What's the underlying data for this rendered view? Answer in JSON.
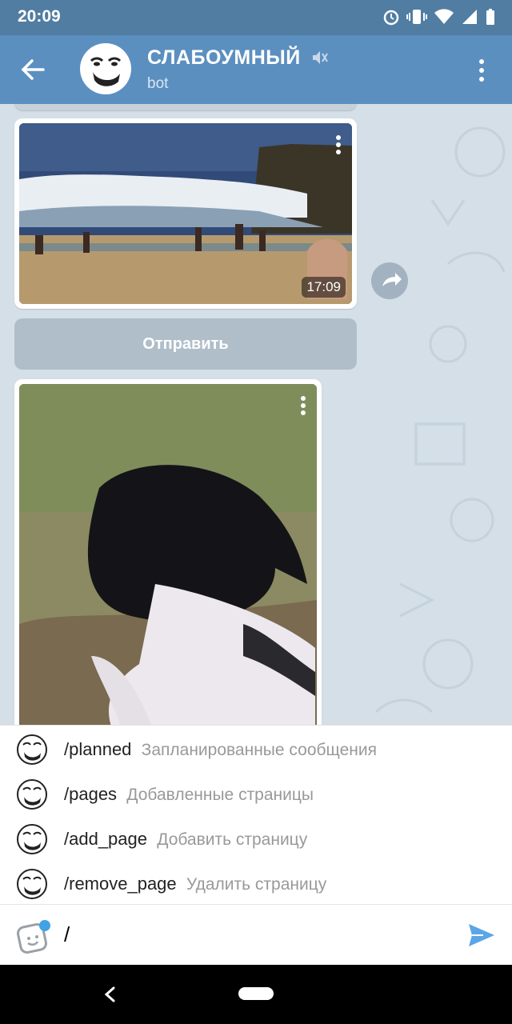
{
  "status_bar": {
    "time": "20:09"
  },
  "header": {
    "title": "СЛАБОУМНЫЙ",
    "subtitle": "bot"
  },
  "chat": {
    "video_duration": "17:09",
    "send_button_label": "Отправить"
  },
  "commands": [
    {
      "name": "/planned",
      "description": "Запланированные сообщения"
    },
    {
      "name": "/pages",
      "description": "Добавленные страницы"
    },
    {
      "name": "/add_page",
      "description": "Добавить страницу"
    },
    {
      "name": "/remove_page",
      "description": "Удалить страницу"
    }
  ],
  "input": {
    "value": "/"
  },
  "colors": {
    "header": "#5b8fc0",
    "status_bar": "#517da2",
    "send_accent": "#5aa6e6",
    "chat_bg": "#d4dfe7"
  }
}
